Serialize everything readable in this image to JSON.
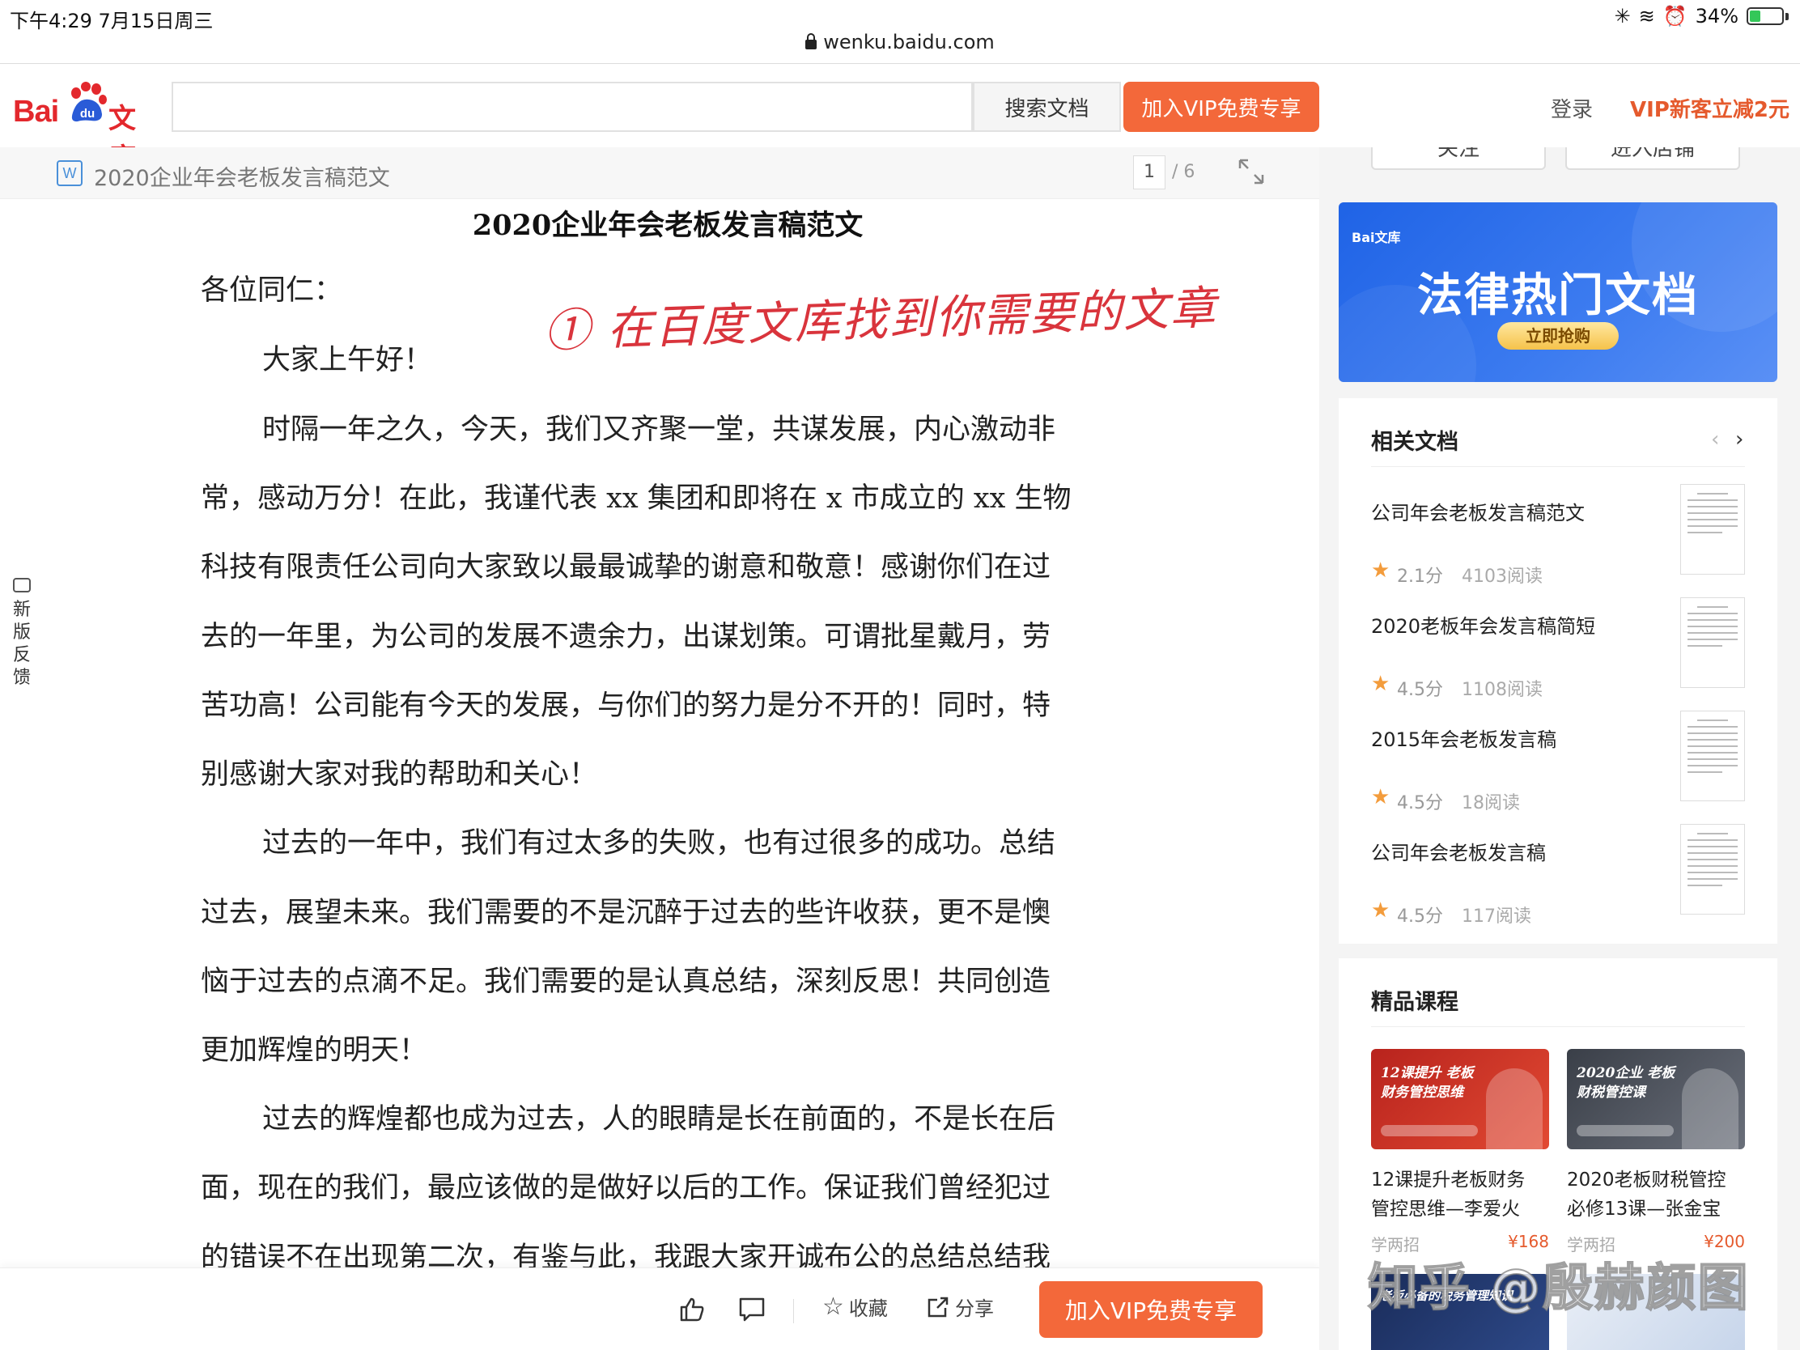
{
  "status_bar": {
    "time_date": "下午4:29   7月15日周三",
    "battery_text": "34%",
    "battery_level": 0.34
  },
  "url_bar": {
    "url": "wenku.baidu.com"
  },
  "header": {
    "logo_bai": "Bai",
    "logo_du": "du",
    "logo_wenku": "文库",
    "search_placeholder": "",
    "search_button": "搜索文档",
    "vip_button": "加入VIP免费专享",
    "login": "登录",
    "vip_discount": "VIP新客立减2元"
  },
  "doc_toolbar": {
    "file_type_icon": "W",
    "title": "2020企业年会老板发言稿范文",
    "page_current": "1",
    "page_total": "/ 6"
  },
  "document": {
    "heading": "2020企业年会老板发言稿范文",
    "lines": [
      "各位同仁：",
      "大家上午好！",
      "时隔一年之久，今天，我们又齐聚一堂，共谋发展，内心激动非",
      "常，感动万分！在此，我谨代表 xx 集团和即将在 x 市成立的 xx 生物",
      "科技有限责任公司向大家致以最最诚挚的谢意和敬意！感谢你们在过",
      "去的一年里，为公司的发展不遗余力，出谋划策。可谓批星戴月，劳",
      "苦功高！公司能有今天的发展，与你们的努力是分不开的！同时，特",
      "别感谢大家对我的帮助和关心！",
      "过去的一年中，我们有过太多的失败，也有过很多的成功。总结",
      "过去，展望未来。我们需要的不是沉醉于过去的些许收获，更不是懊",
      "恼于过去的点滴不足。我们需要的是认真总结，深刻反思！共同创造",
      "更加辉煌的明天！",
      "过去的辉煌都也成为过去，人的眼睛是长在前面的，不是长在后",
      "面，现在的我们，最应该做的是做好以后的工作。保证我们曾经犯过",
      "的错误不在出现第二次，有鉴与此，我跟大家开诚布公的总结总结我"
    ],
    "handwritten_note": "① 在百度文库找到你需要的文章"
  },
  "feedback_tab": {
    "label": [
      "新",
      "版",
      "反",
      "馈"
    ]
  },
  "bottom_bar": {
    "collect": "收藏",
    "share": "分享",
    "vip_button": "加入VIP免费专享"
  },
  "sidebar": {
    "top_buttons": [
      "关注",
      "进入店铺"
    ],
    "banner": {
      "brand": "Bai文库",
      "title": "法律热门文档",
      "button": "立即抢购",
      "color": "#2a6ded"
    },
    "related": {
      "title": "相关文档",
      "prev_icon": "‹",
      "next_icon": "›",
      "items": [
        {
          "title": "公司年会老板发言稿范文",
          "score": "2.1分",
          "reads": "4103阅读"
        },
        {
          "title": "2020老板年会发言稿简短",
          "score": "4.5分",
          "reads": "1108阅读"
        },
        {
          "title": "2015年会老板发言稿",
          "score": "4.5分",
          "reads": "18阅读"
        },
        {
          "title": "公司年会老板发言稿",
          "score": "4.5分",
          "reads": "117阅读"
        }
      ]
    },
    "courses": {
      "title": "精品课程",
      "items": [
        {
          "image_text": "12课提升 老板财务管控思维",
          "name_line1": "12课提升老板财务",
          "name_line2": "管控思维—李爱火",
          "source": "学两招",
          "price": "¥168"
        },
        {
          "image_text": "2020企业 老板财税管控课",
          "name_line1": "2020老板财税管控",
          "name_line2": "必修13课—张金宝",
          "source": "学两招",
          "price": "¥200"
        }
      ],
      "more_image_text": "老板必备的税务管理知识"
    }
  },
  "watermark": "知乎 @殷赫颜图",
  "colors": {
    "accent_orange": "#f3683a",
    "baidu_red": "#e3282d",
    "star": "#f39c3c",
    "note_red": "#d9343c"
  }
}
